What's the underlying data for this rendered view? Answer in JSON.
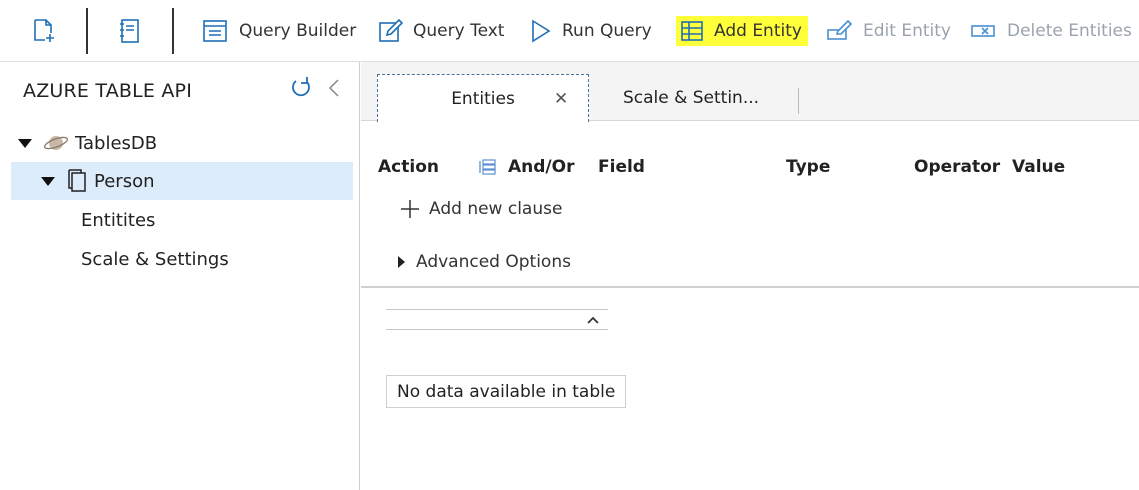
{
  "toolbar": {
    "query_builder": "Query Builder",
    "query_text": "Query Text",
    "run_query": "Run Query",
    "add_entity": "Add Entity",
    "edit_entity": "Edit Entity",
    "delete_entities": "Delete Entities",
    "highlight_color": "#ffff3a",
    "accent_color": "#1f6fb5",
    "disabled_color": "#9aa3ad"
  },
  "sidebar": {
    "title": "AZURE TABLE API",
    "tree": {
      "database": "TablesDB",
      "table": "Person",
      "children": [
        "Entitites",
        "Scale & Settings"
      ]
    }
  },
  "tabs": [
    {
      "label": "Entities",
      "active": true
    },
    {
      "label": "Scale & Settin...",
      "active": false
    }
  ],
  "query": {
    "headers": {
      "action": "Action",
      "and_or": "And/Or",
      "field": "Field",
      "type": "Type",
      "operator": "Operator",
      "value": "Value"
    },
    "add_clause": "Add new clause",
    "advanced_options": "Advanced Options"
  },
  "results": {
    "empty_message": "No data available in table"
  }
}
